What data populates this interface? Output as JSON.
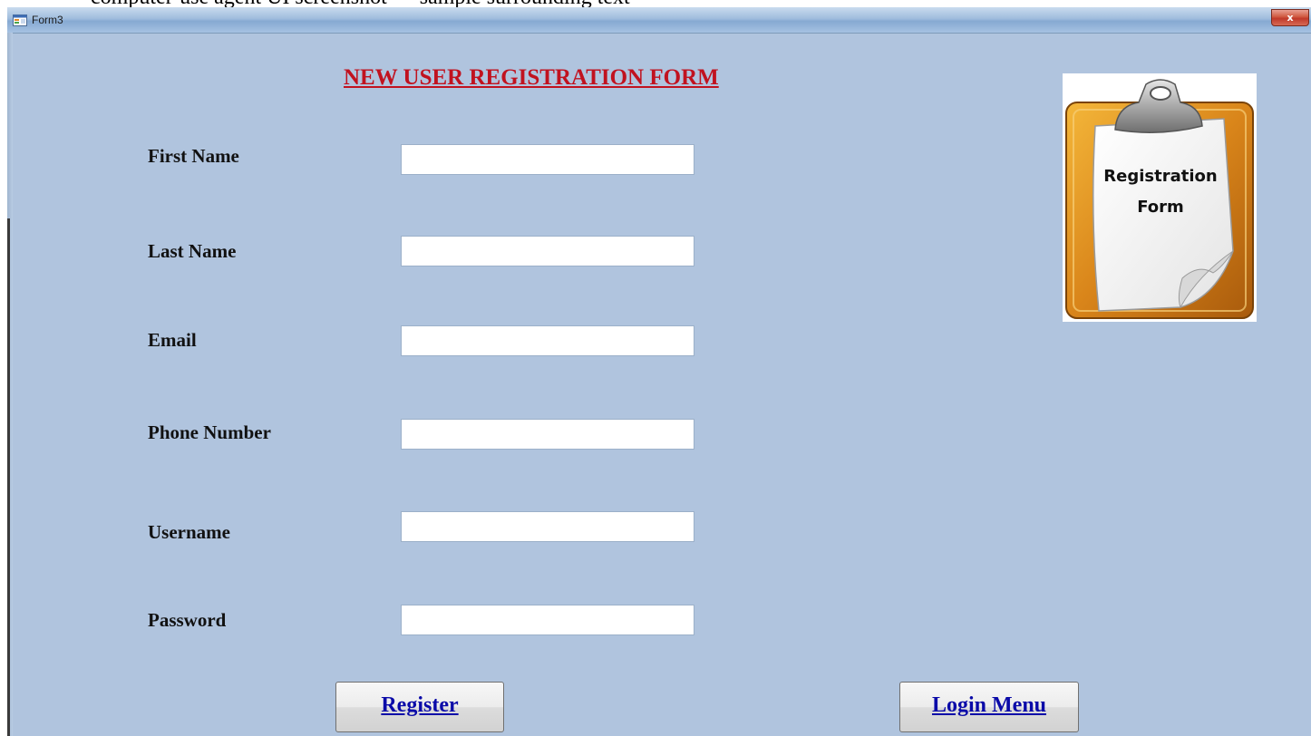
{
  "page_caption": "computer-use agent UI screenshot — sample surrounding text",
  "window": {
    "title": "Form3",
    "close_glyph": "x"
  },
  "form": {
    "heading": "NEW USER REGISTRATION FORM",
    "fields": [
      {
        "label": "First Name",
        "value": ""
      },
      {
        "label": "Last Name",
        "value": ""
      },
      {
        "label": "Email",
        "value": ""
      },
      {
        "label": "Phone Number",
        "value": ""
      },
      {
        "label": "Username",
        "value": ""
      },
      {
        "label": "Password",
        "value": ""
      }
    ]
  },
  "buttons": {
    "register": "Register",
    "login_menu": "Login Menu"
  },
  "image": {
    "caption_line1": "Registration",
    "caption_line2": "Form"
  },
  "colors": {
    "background": "#b0c4de",
    "heading": "#c1121f",
    "button_text": "#0a0aa8"
  }
}
